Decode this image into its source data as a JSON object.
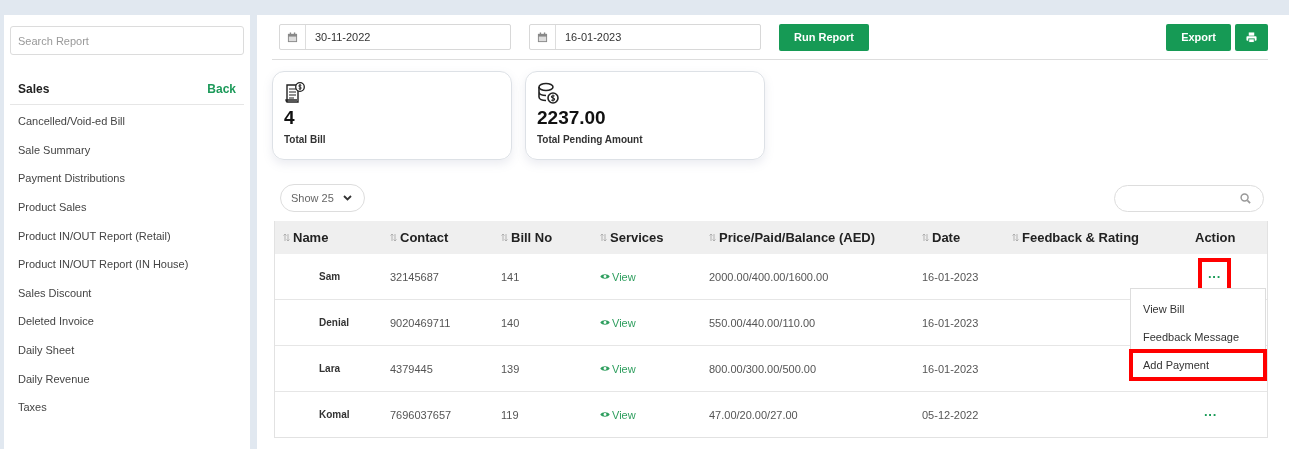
{
  "sidebar": {
    "search": {
      "placeholder": "Search Report"
    },
    "section": "Sales",
    "back": "Back",
    "items": [
      "Cancelled/Void-ed Bill",
      "Sale Summary",
      "Payment Distributions",
      "Product Sales",
      "Product IN/OUT Report (Retail)",
      "Product IN/OUT Report (IN House)",
      "Sales Discount",
      "Deleted Invoice",
      "Daily Sheet",
      "Daily Revenue",
      "Taxes"
    ]
  },
  "toolbar": {
    "from_date": "30-11-2022",
    "to_date": "16-01-2023",
    "run_button": "Run Report",
    "export_button": "Export"
  },
  "stats": [
    {
      "kind": "bill",
      "value": "4",
      "label": "Total Bill"
    },
    {
      "kind": "coins",
      "value": "2237.00",
      "label": "Total Pending Amount"
    }
  ],
  "table": {
    "page_size": "Show 25",
    "columns": [
      {
        "label": "Name",
        "sortable": true
      },
      {
        "label": "Contact",
        "sortable": true
      },
      {
        "label": "Bill No",
        "sortable": true
      },
      {
        "label": "Services",
        "sortable": true
      },
      {
        "label": "Price/Paid/Balance (AED)",
        "sortable": true
      },
      {
        "label": "Date",
        "sortable": true
      },
      {
        "label": "Feedback & Rating",
        "sortable": true
      },
      {
        "label": "Action",
        "sortable": false
      }
    ],
    "rows": [
      {
        "name": "Sam",
        "contact": "32145687",
        "bill_no": "141",
        "services": "View",
        "amounts": "2000.00/400.00/1600.00",
        "date": "16-01-2023",
        "action": "···",
        "highlighted": true
      },
      {
        "name": "Denial",
        "contact": "9020469711",
        "bill_no": "140",
        "services": "View",
        "amounts": "550.00/440.00/110.00",
        "date": "16-01-2023"
      },
      {
        "name": "Lara",
        "contact": "4379445",
        "bill_no": "139",
        "services": "View",
        "amounts": "800.00/300.00/500.00",
        "date": "16-01-2023"
      },
      {
        "name": "Komal",
        "contact": "7696037657",
        "bill_no": "119",
        "services": "View",
        "amounts": "47.00/20.00/27.00",
        "date": "05-12-2022",
        "action": "···",
        "highlighted": false
      }
    ],
    "action_menu": [
      {
        "label": "View Bill",
        "highlighted": false
      },
      {
        "label": "Feedback Message",
        "highlighted": false
      },
      {
        "label": "Add Payment",
        "highlighted": true
      }
    ]
  }
}
